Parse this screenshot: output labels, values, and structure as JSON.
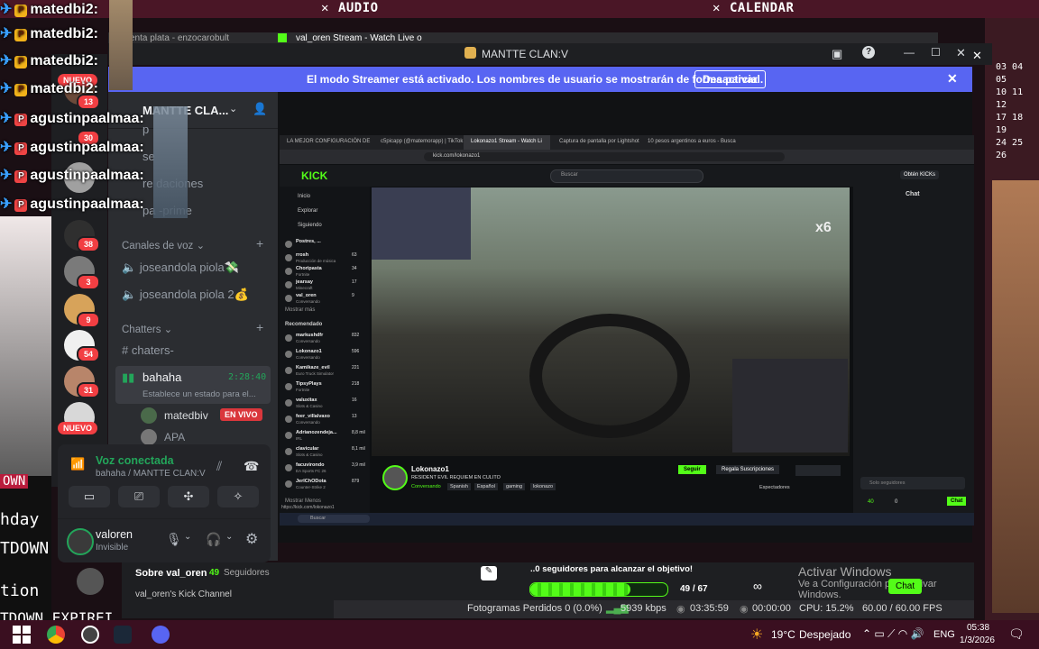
{
  "overlay": {
    "top_items": [
      {
        "label": "AUDIO"
      },
      {
        "label": "CALENDAR"
      }
    ],
    "chat_lines": [
      {
        "user": "matedbi2:"
      },
      {
        "user": "matedbi2:"
      },
      {
        "user": "matedbi2:"
      },
      {
        "user": "matedbi2:"
      },
      {
        "user": "agustinpaalmaa:"
      },
      {
        "user": "agustinpaalmaa:"
      },
      {
        "user": "agustinpaalmaa:"
      },
      {
        "user": "agustinpaalmaa:"
      }
    ],
    "left_texts": [
      "OWN",
      "hday",
      "TDOWN",
      "tion",
      "TDOWN EXPIREI"
    ],
    "calendar_rows": [
      "03 04 05",
      "10 11 12",
      "17 18 19",
      "24 25 26"
    ],
    "activate_windows": {
      "title": "Activar Windows",
      "subtitle": "Ve a Configuración para activar Windows."
    }
  },
  "rail": {
    "nuevo_top": "NUEVO",
    "nuevo_bottom": "NUEVO",
    "badges": [
      "13",
      "30",
      "38",
      "3",
      "9",
      "54",
      "31"
    ]
  },
  "background_browser": {
    "tabs": [
      "enta plata - enzocarobult",
      "val_oren Stream - Watch Live o"
    ]
  },
  "discord": {
    "window_title": "MANTTE CLAN:V",
    "streamer_banner": {
      "text": "El modo Streamer está activado. Los nombres de usuario se mostrarán de forma parcial.",
      "button": "Desactivar"
    },
    "server_name": "MANTTE CLA...",
    "channels_partial": [
      "p",
      "se",
      "re     daciones",
      "pa       -prime"
    ],
    "voice_category": "Canales de voz",
    "voice_channels": [
      "joseandola piola💸",
      "joseandola piola 2💰"
    ],
    "chatters_category": "Chatters",
    "text_channel": "chaters-",
    "active_voice": {
      "name": "bahaha",
      "timer": "2:28:40",
      "status": "Establece un estado para el..."
    },
    "members": [
      {
        "name": "matedbiv",
        "badge": "EN VIVO"
      },
      {
        "name": "APA",
        "badge": ""
      }
    ],
    "voice_panel": {
      "status": "Voz conectada",
      "location": "bahaha / MANTTE CLAN:V"
    },
    "user": {
      "name": "valoren",
      "status": "Invisible"
    }
  },
  "kick": {
    "tabs": [
      "LA MEJOR CONFIGURACIÓN DE",
      "c5picapp (@matemorapp) | TikTok",
      "Lokonazo1 Stream - Watch Li",
      "Captura de pantalla por Lightshot",
      "10 pesos argentinos a euros - Busca"
    ],
    "url": "kick.com/lokonazo1",
    "logo": "KICK",
    "search_placeholder": "Buscar",
    "get_kicks": "Obtén KICKs",
    "nav": [
      "Inicio",
      "Explorar",
      "Siguiendo"
    ],
    "following": [
      {
        "name": "Postres, ...",
        "meta": "",
        "viewers": ""
      },
      {
        "name": "rrosh",
        "meta": "Producción de música",
        "viewers": "63"
      },
      {
        "name": "Choripasta",
        "meta": "Fortnite",
        "viewers": "34"
      },
      {
        "name": "jearsay",
        "meta": "Minecraft",
        "viewers": "17"
      },
      {
        "name": "val_oren",
        "meta": "Conversando",
        "viewers": "9"
      }
    ],
    "show_more": "Mostrar más",
    "recommended_title": "Recomendado",
    "recommended": [
      {
        "name": "markushdfr",
        "meta": "Conversando",
        "viewers": "832"
      },
      {
        "name": "Lokonazo1",
        "meta": "Conversando",
        "viewers": "596"
      },
      {
        "name": "Kamikaze_evil",
        "meta": "Euro Truck Simulator",
        "viewers": "221"
      },
      {
        "name": "TipsyPlays",
        "meta": "Fortnite",
        "viewers": "218"
      },
      {
        "name": "valuxitax",
        "meta": "Slots & Casino",
        "viewers": "16"
      },
      {
        "name": "feer_villalvaxo",
        "meta": "Conversando",
        "viewers": "13"
      },
      {
        "name": "Adrianozendeja...",
        "meta": "IRL",
        "viewers": "8,8 mil"
      },
      {
        "name": "clavicular",
        "meta": "Slots & Casino",
        "viewers": "8,1 mil"
      },
      {
        "name": "facuvirondo",
        "meta": "EA Sports FC 26",
        "viewers": "3,9 mil"
      },
      {
        "name": "JerIChODota",
        "meta": "Counter-Strike 2",
        "viewers": "879"
      }
    ],
    "show_more_bottom": "Mostrar Menos",
    "chat_title": "Chat",
    "game_overlay": "x6",
    "streamer": {
      "name": "Lokonazo1",
      "title": "RESIDENT EVIL REQUIEM EN CULITO",
      "category": "Conversando",
      "tags": [
        "Spanish",
        "Español",
        "gaming",
        "lokonazo"
      ]
    },
    "follow_button": "Seguir",
    "subs_button": "Regala Suscripciones",
    "viewers_label": "Espectadores",
    "chat_input_placeholder": "Solo seguidores",
    "chat_counts": [
      "40",
      "0"
    ],
    "chat_button": "Chat",
    "status_url": "https://kick.com/lokonazo1",
    "taskbar_search": "Buscar"
  },
  "profile_strip": {
    "about": "Sobre val_oren",
    "followers_count": "49",
    "followers_label": "Seguidores",
    "channel_desc": "val_oren's Kick Channel",
    "goal_text": "..0 seguidores para alcanzar el objetivo!",
    "goal_progress": 0.73,
    "goal_count": "49 / 67",
    "infinity": "∞",
    "chat_button": "Chat"
  },
  "obs_status": {
    "dropped": "Fotogramas Perdidos 0 (0.0%)",
    "bitrate": "5939 kbps",
    "rec_time": "03:35:59",
    "stream_time": "00:00:00",
    "cpu": "CPU: 15.2%",
    "fps": "60.00 / 60.00 FPS"
  },
  "taskbar": {
    "weather_temp": "19°C",
    "weather_desc": "Despejado",
    "lang": "ENG",
    "time": "05:38",
    "date": "1/3/2026"
  }
}
